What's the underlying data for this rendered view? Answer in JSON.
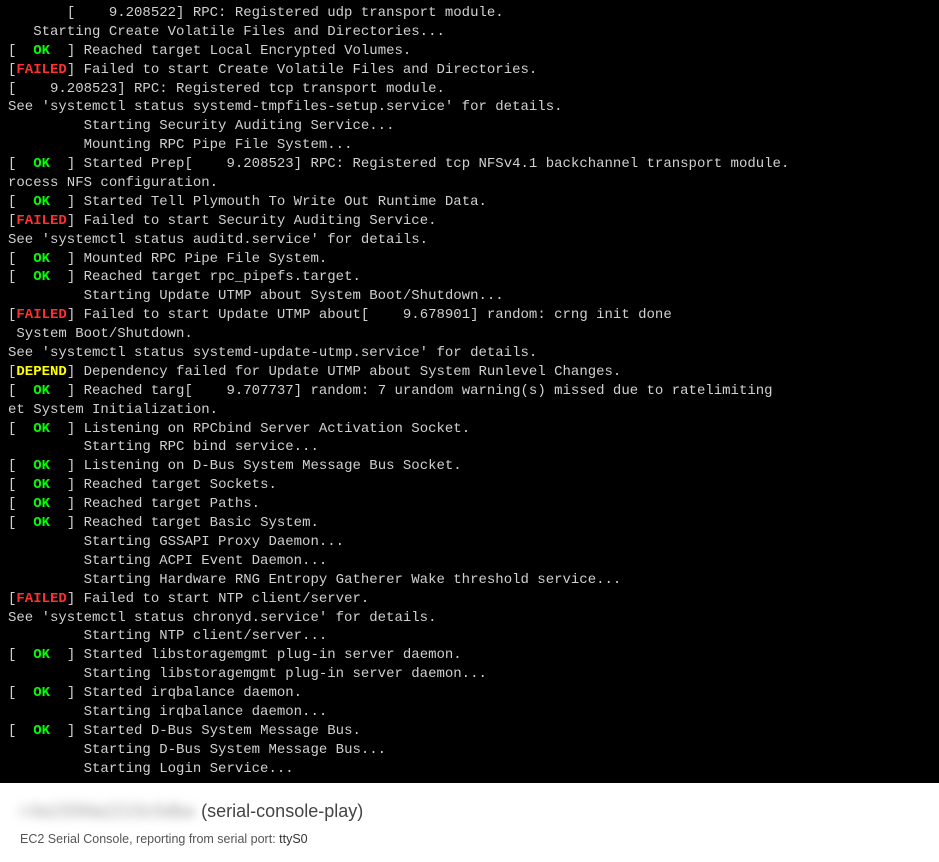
{
  "console": {
    "lines": [
      {
        "status": null,
        "text": "       [    9.208522] RPC: Registered udp transport module."
      },
      {
        "status": null,
        "text": "   Starting Create Volatile Files and Directories..."
      },
      {
        "status": "OK",
        "text": "Reached target Local Encrypted Volumes."
      },
      {
        "status": "FAILED",
        "text": "Failed to start Create Volatile Files and Directories."
      },
      {
        "status": null,
        "text": "[    9.208523] RPC: Registered tcp transport module."
      },
      {
        "status": null,
        "text": "See 'systemctl status systemd-tmpfiles-setup.service' for details."
      },
      {
        "status": null,
        "text": "         Starting Security Auditing Service..."
      },
      {
        "status": null,
        "text": "         Mounting RPC Pipe File System..."
      },
      {
        "status": "OK",
        "text": "Started Prep[    9.208523] RPC: Registered tcp NFSv4.1 backchannel transport module."
      },
      {
        "status": null,
        "text": "rocess NFS configuration."
      },
      {
        "status": "OK",
        "text": "Started Tell Plymouth To Write Out Runtime Data."
      },
      {
        "status": "FAILED",
        "text": "Failed to start Security Auditing Service."
      },
      {
        "status": null,
        "text": "See 'systemctl status auditd.service' for details."
      },
      {
        "status": "OK",
        "text": "Mounted RPC Pipe File System."
      },
      {
        "status": "OK",
        "text": "Reached target rpc_pipefs.target."
      },
      {
        "status": null,
        "text": "         Starting Update UTMP about System Boot/Shutdown..."
      },
      {
        "status": "FAILED",
        "text": "Failed to start Update UTMP about[    9.678901] random: crng init done"
      },
      {
        "status": null,
        "text": " System Boot/Shutdown."
      },
      {
        "status": null,
        "text": "See 'systemctl status systemd-update-utmp.service' for details."
      },
      {
        "status": "DEPEND",
        "text": "Dependency failed for Update UTMP about System Runlevel Changes."
      },
      {
        "status": "OK",
        "text": "Reached targ[    9.707737] random: 7 urandom warning(s) missed due to ratelimiting"
      },
      {
        "status": null,
        "text": "et System Initialization."
      },
      {
        "status": "OK",
        "text": "Listening on RPCbind Server Activation Socket."
      },
      {
        "status": null,
        "text": "         Starting RPC bind service..."
      },
      {
        "status": "OK",
        "text": "Listening on D-Bus System Message Bus Socket."
      },
      {
        "status": "OK",
        "text": "Reached target Sockets."
      },
      {
        "status": "OK",
        "text": "Reached target Paths."
      },
      {
        "status": "OK",
        "text": "Reached target Basic System."
      },
      {
        "status": null,
        "text": "         Starting GSSAPI Proxy Daemon..."
      },
      {
        "status": null,
        "text": "         Starting ACPI Event Daemon..."
      },
      {
        "status": null,
        "text": "         Starting Hardware RNG Entropy Gatherer Wake threshold service..."
      },
      {
        "status": "FAILED",
        "text": "Failed to start NTP client/server."
      },
      {
        "status": null,
        "text": "See 'systemctl status chronyd.service' for details."
      },
      {
        "status": null,
        "text": "         Starting NTP client/server..."
      },
      {
        "status": "OK",
        "text": "Started libstoragemgmt plug-in server daemon."
      },
      {
        "status": null,
        "text": "         Starting libstoragemgmt plug-in server daemon..."
      },
      {
        "status": "OK",
        "text": "Started irqbalance daemon."
      },
      {
        "status": null,
        "text": "         Starting irqbalance daemon..."
      },
      {
        "status": "OK",
        "text": "Started D-Bus System Message Bus."
      },
      {
        "status": null,
        "text": "         Starting D-Bus System Message Bus..."
      },
      {
        "status": null,
        "text": "         Starting Login Service..."
      }
    ]
  },
  "footer": {
    "instance_id_blur": "i-0a155fda2215c5dba",
    "title_suffix": "(serial-console-play)",
    "sub_prefix": "EC2 Serial Console, reporting from serial port: ",
    "port": "ttyS0"
  },
  "status_labels": {
    "OK": "  OK  ",
    "FAILED": "FAILED",
    "DEPEND": "DEPEND"
  }
}
